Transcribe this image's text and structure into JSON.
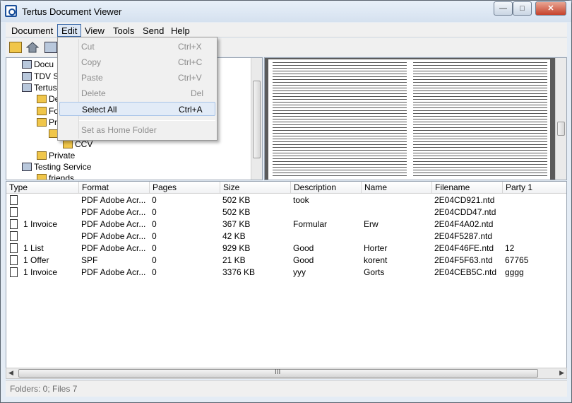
{
  "window": {
    "title": "Tertus Document Viewer",
    "controls": {
      "minimize": "—",
      "maximize": "□",
      "close": "✕"
    }
  },
  "menubar": [
    "Document",
    "Edit",
    "View",
    "Tools",
    "Send",
    "Help"
  ],
  "edit_menu": [
    {
      "label": "Cut",
      "shortcut": "Ctrl+X",
      "enabled": false
    },
    {
      "label": "Copy",
      "shortcut": "Ctrl+C",
      "enabled": false
    },
    {
      "label": "Paste",
      "shortcut": "Ctrl+V",
      "enabled": false
    },
    {
      "label": "Delete",
      "shortcut": "Del",
      "enabled": false
    },
    {
      "label": "Select All",
      "shortcut": "Ctrl+A",
      "enabled": true,
      "highlighted": true
    },
    {
      "label": "Set as Home Folder",
      "shortcut": "",
      "enabled": false
    }
  ],
  "tree": [
    {
      "label": "Docu",
      "icon": "tree-root-icon"
    },
    {
      "label": "TDV S",
      "icon": "computer-icon"
    },
    {
      "label": "Tertus",
      "icon": "computer-icon"
    },
    {
      "label": "De",
      "icon": "folder-icon"
    },
    {
      "label": "Fo",
      "icon": "folder-icon"
    },
    {
      "label": "Pr",
      "icon": "folder-icon"
    },
    {
      "label": "",
      "icon": "folder-icon"
    },
    {
      "label": "CCV",
      "icon": "folder-icon"
    },
    {
      "label": "Private",
      "icon": "folder-icon"
    },
    {
      "label": "Testing Service",
      "icon": "computer-icon"
    },
    {
      "label": "friends",
      "icon": "folder-icon"
    }
  ],
  "columns": [
    "Type",
    "Format",
    "Pages",
    "Size",
    "Description",
    "Name",
    "Filename",
    "Party 1"
  ],
  "rows": [
    {
      "type": "",
      "format": "PDF Adobe Acr...",
      "pages": "0",
      "size": "502 KB",
      "description": "took",
      "name": "",
      "filename": "2E04CD921.ntd",
      "party1": ""
    },
    {
      "type": "",
      "format": "PDF Adobe Acr...",
      "pages": "0",
      "size": "502 KB",
      "description": "",
      "name": "",
      "filename": "2E04CDD47.ntd",
      "party1": ""
    },
    {
      "type": "1 Invoice",
      "format": "PDF Adobe Acr...",
      "pages": "0",
      "size": "367 KB",
      "description": "Formular",
      "name": "Erw",
      "filename": "2E04F4A02.ntd",
      "party1": ""
    },
    {
      "type": "",
      "format": "PDF Adobe Acr...",
      "pages": "0",
      "size": "42 KB",
      "description": "",
      "name": "",
      "filename": "2E04F5287.ntd",
      "party1": ""
    },
    {
      "type": "1 List",
      "format": "PDF Adobe Acr...",
      "pages": "0",
      "size": "929 KB",
      "description": "Good",
      "name": "Horter",
      "filename": "2E04F46FE.ntd",
      "party1": "12"
    },
    {
      "type": "1 Offer",
      "format": "SPF",
      "pages": "0",
      "size": "21 KB",
      "description": "Good",
      "name": "korent",
      "filename": "2E04F5F63.ntd",
      "party1": "67765"
    },
    {
      "type": "1 Invoice",
      "format": "PDF Adobe Acr...",
      "pages": "0",
      "size": "3376 KB",
      "description": "yyy",
      "name": "Gorts",
      "filename": "2E04CEB5C.ntd",
      "party1": "gggg"
    }
  ],
  "status": "Folders: 0; Files 7",
  "hscroll_grip": "III"
}
